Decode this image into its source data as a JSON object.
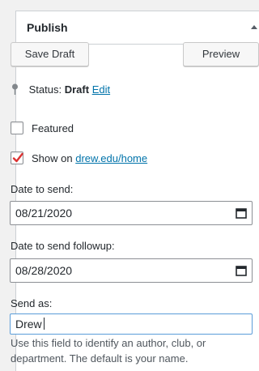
{
  "publish": {
    "title": "Publish",
    "save_draft_label": "Save Draft",
    "preview_label": "Preview",
    "status_prefix": "Status:",
    "status_value": "Draft",
    "status_edit": "Edit",
    "featured_label": "Featured",
    "featured_checked": false,
    "show_on_prefix": "Show on",
    "show_on_link": "drew.edu/home",
    "show_on_checked": true,
    "date_to_send_label": "Date to send:",
    "date_to_send_value": "08/21/2020",
    "followup_label": "Date to send followup:",
    "followup_value": "08/28/2020",
    "send_as_label": "Send as:",
    "send_as_value": "Drew",
    "send_as_help": "Use this field to identify an author, club, or department. The default is your name."
  },
  "colors": {
    "link": "#0073aa",
    "checkmark": "#dc3232"
  },
  "icons": [
    "chevron-up-icon",
    "pin-icon",
    "checkmark-icon",
    "calendar-icon"
  ]
}
